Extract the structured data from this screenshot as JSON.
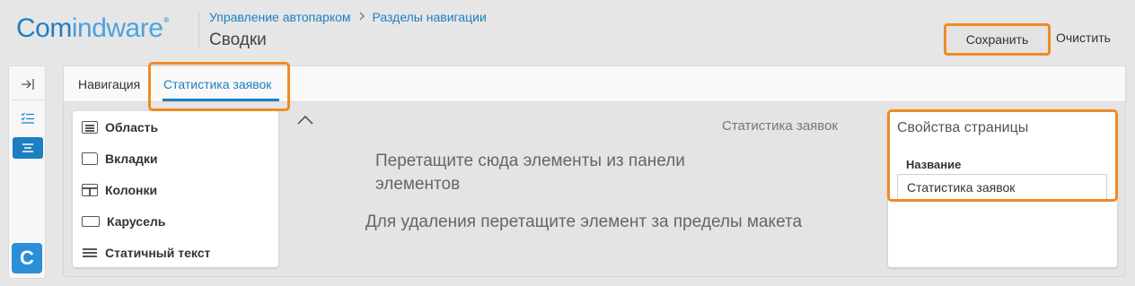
{
  "header": {
    "logo_part1": "Com",
    "logo_part2": "indware",
    "logo_reg": "®",
    "breadcrumb": [
      "Управление автопарком",
      "Разделы навигации"
    ],
    "breadcrumb_separator": ">",
    "title": "Сводки",
    "save_label": "Сохранить",
    "clear_label": "Очистить"
  },
  "rail": {
    "items": [
      {
        "icon": "expand-sidebar-icon",
        "glyph": "→|"
      },
      {
        "icon": "checklist-icon",
        "glyph": "☰"
      },
      {
        "icon": "list-icon",
        "glyph": "≡",
        "active": true
      }
    ],
    "app_letter": "C"
  },
  "tabs": [
    {
      "label": "Навигация",
      "active": false
    },
    {
      "label": "Статистика заявок",
      "active": true
    }
  ],
  "palette": {
    "items": [
      {
        "label": "Область",
        "icon": "area-icon"
      },
      {
        "label": "Вкладки",
        "icon": "tabs-icon"
      },
      {
        "label": "Колонки",
        "icon": "columns-icon"
      },
      {
        "label": "Карусель",
        "icon": "carousel-icon"
      },
      {
        "label": "Статичный текст",
        "icon": "static-text-icon"
      }
    ]
  },
  "canvas": {
    "title": "Статистика заявок",
    "drop_hint": "Перетащите сюда элементы из панели элементов",
    "remove_hint": "Для удаления перетащите элемент за пределы макета",
    "collapse_glyph": "︿"
  },
  "properties": {
    "title": "Свойства страницы",
    "name_label": "Название",
    "name_value": "Статистика заявок"
  },
  "colors": {
    "accent": "#1d7fc2",
    "highlight": "#f08a24"
  }
}
